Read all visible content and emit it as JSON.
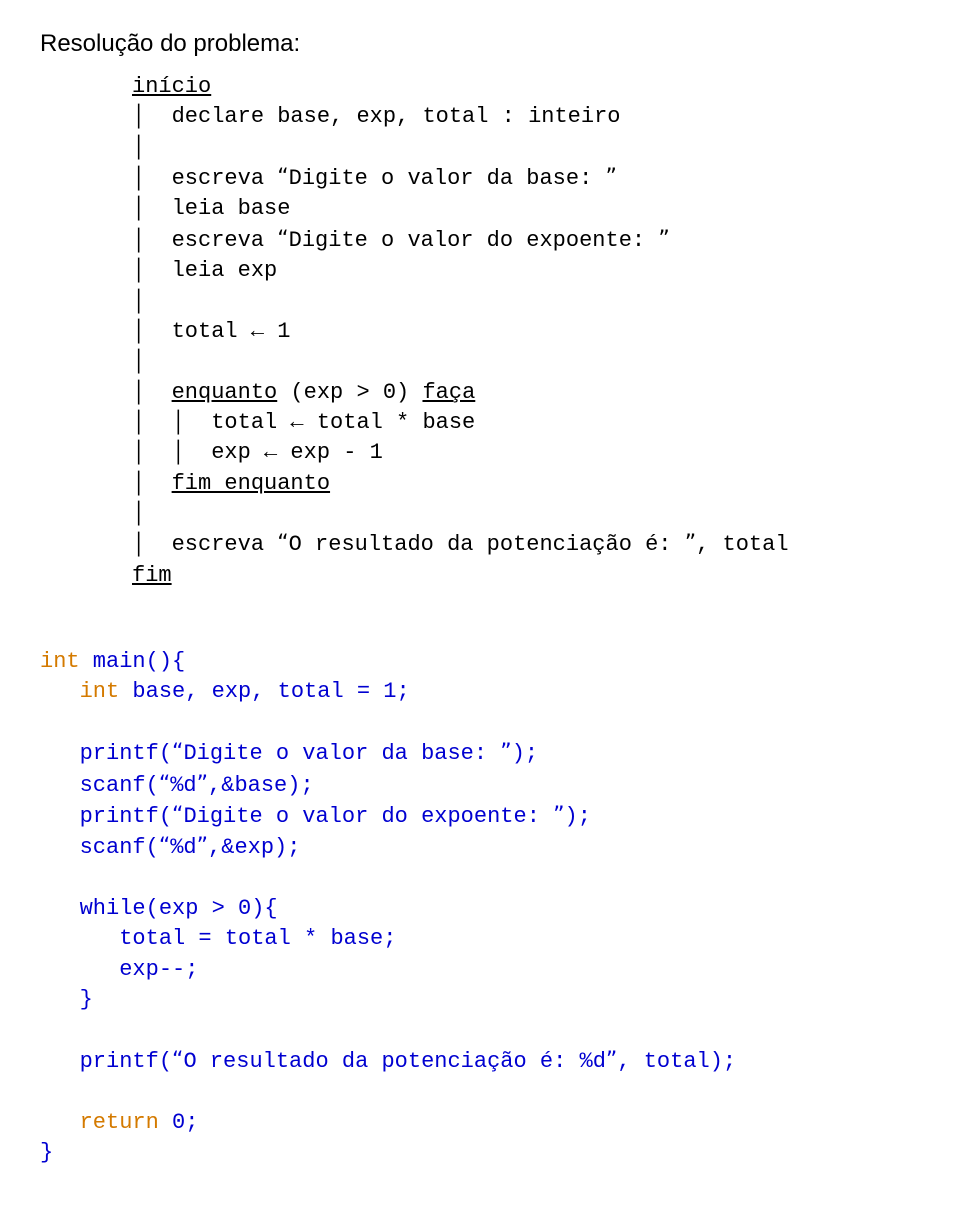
{
  "heading": "Resolução do problema:",
  "pseudo": {
    "inicio": "início",
    "declare": "declare base, exp, total : inteiro",
    "escreva1a": "escreva ",
    "escreva1b": "Digite o valor da base: ",
    "leia1": "leia base",
    "escreva2a": "escreva ",
    "escreva2b": "Digite o valor do expoente: ",
    "leia2": "leia exp",
    "total1": "total ← 1",
    "enquanto_u": "enquanto",
    "enquanto_mid": " (exp > 0) ",
    "faca_u": "faça",
    "enq_line1": "total ← total * base",
    "enq_line2": "exp ← exp - 1",
    "fim_enquanto": "fim enquanto",
    "escreva3a": "escreva ",
    "escreva3b": "O resultado da potenciação é: ",
    "escreva3c": ", total",
    "fim": "fim"
  },
  "code": {
    "l1a": "int",
    "l1b": " main(){",
    "l2a": "   int",
    "l2b": " base, exp, total = 1;",
    "l3a": "   printf(",
    "l3b": "Digite o valor da base: ",
    "l3c": ");",
    "l4a": "   scanf(",
    "l4b": "%d",
    "l4c": ",&base);",
    "l5a": "   printf(",
    "l5b": "Digite o valor do expoente: ",
    "l5c": ");",
    "l6a": "   scanf(",
    "l6b": "%d",
    "l6c": ",&exp);",
    "l7": "   while(exp > 0){",
    "l8": "      total = total * base;",
    "l9": "      exp--;",
    "l10": "   }",
    "l11a": "   printf(",
    "l11b": "O resultado da potenciação é: %d",
    "l11c": ", total);",
    "l12a": "   return",
    "l12b": " 0;",
    "l13": "}"
  }
}
